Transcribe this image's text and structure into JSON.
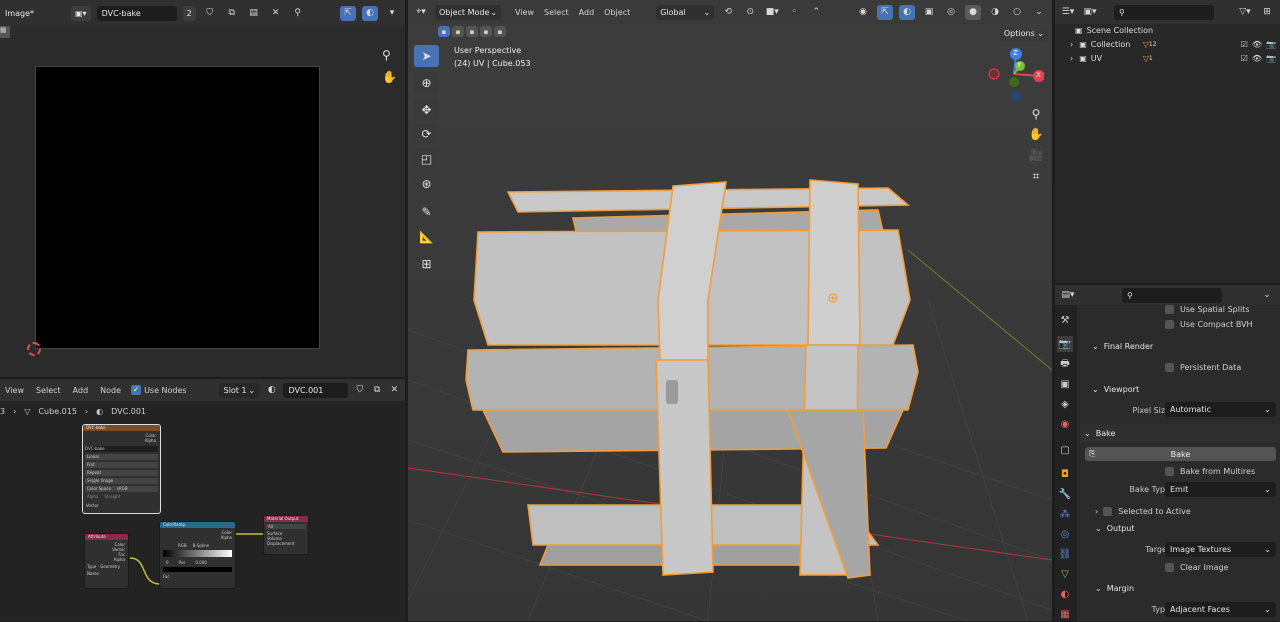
{
  "image_editor": {
    "title": "Image*",
    "image_name": "DVC-bake",
    "users": "2"
  },
  "node_editor": {
    "menus": [
      "View",
      "Select",
      "Add",
      "Node"
    ],
    "use_nodes_label": "Use Nodes",
    "slot": "Slot 1",
    "material": "DVC.001",
    "breadcrumb": {
      "prefix": "3",
      "object": "Cube.015",
      "material": "DVC.001"
    },
    "nodes": {
      "image_texture": {
        "title": "DVC-bake",
        "image": "DVC-bake",
        "outputs": [
          "Color",
          "Alpha"
        ],
        "rows": [
          "Linear",
          "Flat",
          "Repeat",
          "Single Image"
        ],
        "color_space_label": "Color Space",
        "color_space": "sRGB",
        "alpha_label": "Alpha",
        "alpha": "Straight",
        "vector": "Vector"
      },
      "attribute": {
        "title": "Attribute",
        "outputs": [
          "Color",
          "Vector",
          "Fac",
          "Alpha"
        ],
        "type_label": "Type",
        "type": "Geometry",
        "name_label": "Name"
      },
      "color_ramp": {
        "title": "ColorRamp",
        "outputs": [
          "Color",
          "Alpha"
        ],
        "mode": "RGB",
        "interp": "B-Spline",
        "pos": "0",
        "pos_label": "Pos",
        "pos_value": "0.000",
        "input": "Fac"
      },
      "material_output": {
        "title": "Material Output",
        "target": "All",
        "inputs": [
          "Surface",
          "Volume",
          "Displacement"
        ]
      }
    }
  },
  "viewport": {
    "mode": "Object Mode",
    "menus": [
      "View",
      "Select",
      "Add",
      "Object"
    ],
    "transform": "Global",
    "options": "Options",
    "perspective": "User Perspective",
    "object_info": "(24) UV | Cube.053",
    "gizmo": {
      "x": "X",
      "y": "Y",
      "z": "Z"
    }
  },
  "outliner": {
    "root": "Scene Collection",
    "items": [
      {
        "name": "Collection",
        "badge": "12"
      },
      {
        "name": "UV",
        "badge": "1"
      }
    ]
  },
  "properties": {
    "use_spatial_splits": "Use Spatial Splits",
    "use_compact_bvh": "Use Compact BVH",
    "final_render": "Final Render",
    "persistent_data": "Persistent Data",
    "viewport_section": "Viewport",
    "pixel_size_label": "Pixel Size",
    "pixel_size": "Automatic",
    "bake_section": "Bake",
    "bake_button": "Bake",
    "bake_from_multires": "Bake from Multires",
    "bake_type_label": "Bake Type",
    "bake_type": "Emit",
    "selected_to_active": "Selected to Active",
    "output_section": "Output",
    "target_label": "Target",
    "target": "Image Textures",
    "clear_image": "Clear Image",
    "margin_section": "Margin",
    "margin_type_label": "Type",
    "margin_type": "Adjacent Faces"
  },
  "colors": {
    "accent": "#4772b3",
    "selection_outline": "#f29d37",
    "x_axis": "#e5414f",
    "y_axis": "#7bc13a",
    "z_axis": "#3d7fe3"
  }
}
